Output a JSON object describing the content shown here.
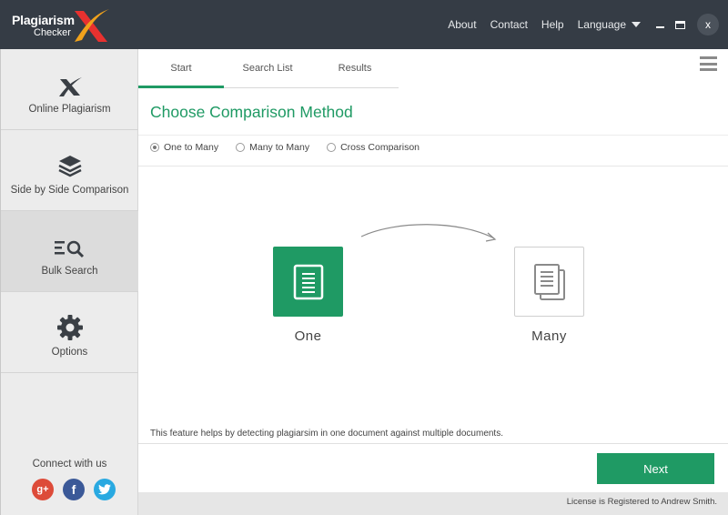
{
  "app": {
    "logo_line1": "Plagiarism",
    "logo_line2": "Checker"
  },
  "topnav": {
    "about": "About",
    "contact": "Contact",
    "help": "Help",
    "language": "Language",
    "close": "x"
  },
  "sidebar": {
    "items": [
      {
        "label": "Online Plagiarism",
        "icon": "x-logo-icon"
      },
      {
        "label": "Side by Side Comparison",
        "icon": "layers-icon"
      },
      {
        "label": "Bulk Search",
        "icon": "list-search-icon"
      },
      {
        "label": "Options",
        "icon": "gear-icon"
      }
    ],
    "connect_label": "Connect with us",
    "socials": [
      {
        "name": "google-plus-icon",
        "glyph": "g+",
        "color": "#dd4b39"
      },
      {
        "name": "facebook-icon",
        "glyph": "f",
        "color": "#3b5998"
      },
      {
        "name": "twitter-icon",
        "glyph": "t",
        "color": "#29a9e1"
      }
    ]
  },
  "tabs": [
    {
      "label": "Start",
      "active": true
    },
    {
      "label": "Search List",
      "active": false
    },
    {
      "label": "Results",
      "active": false
    }
  ],
  "main": {
    "heading": "Choose Comparison Method",
    "radios": [
      {
        "label": "One to Many",
        "checked": true
      },
      {
        "label": "Many to Many",
        "checked": false
      },
      {
        "label": "Cross Comparison",
        "checked": false
      }
    ],
    "one_label": "One",
    "many_label": "Many",
    "description": "This feature helps by detecting plagiarsim in one document against multiple documents.",
    "next_label": "Next"
  },
  "footer": {
    "license": "License is Registered to Andrew Smith."
  },
  "colors": {
    "accent": "#1f9a64",
    "titlebar": "#353c45"
  }
}
